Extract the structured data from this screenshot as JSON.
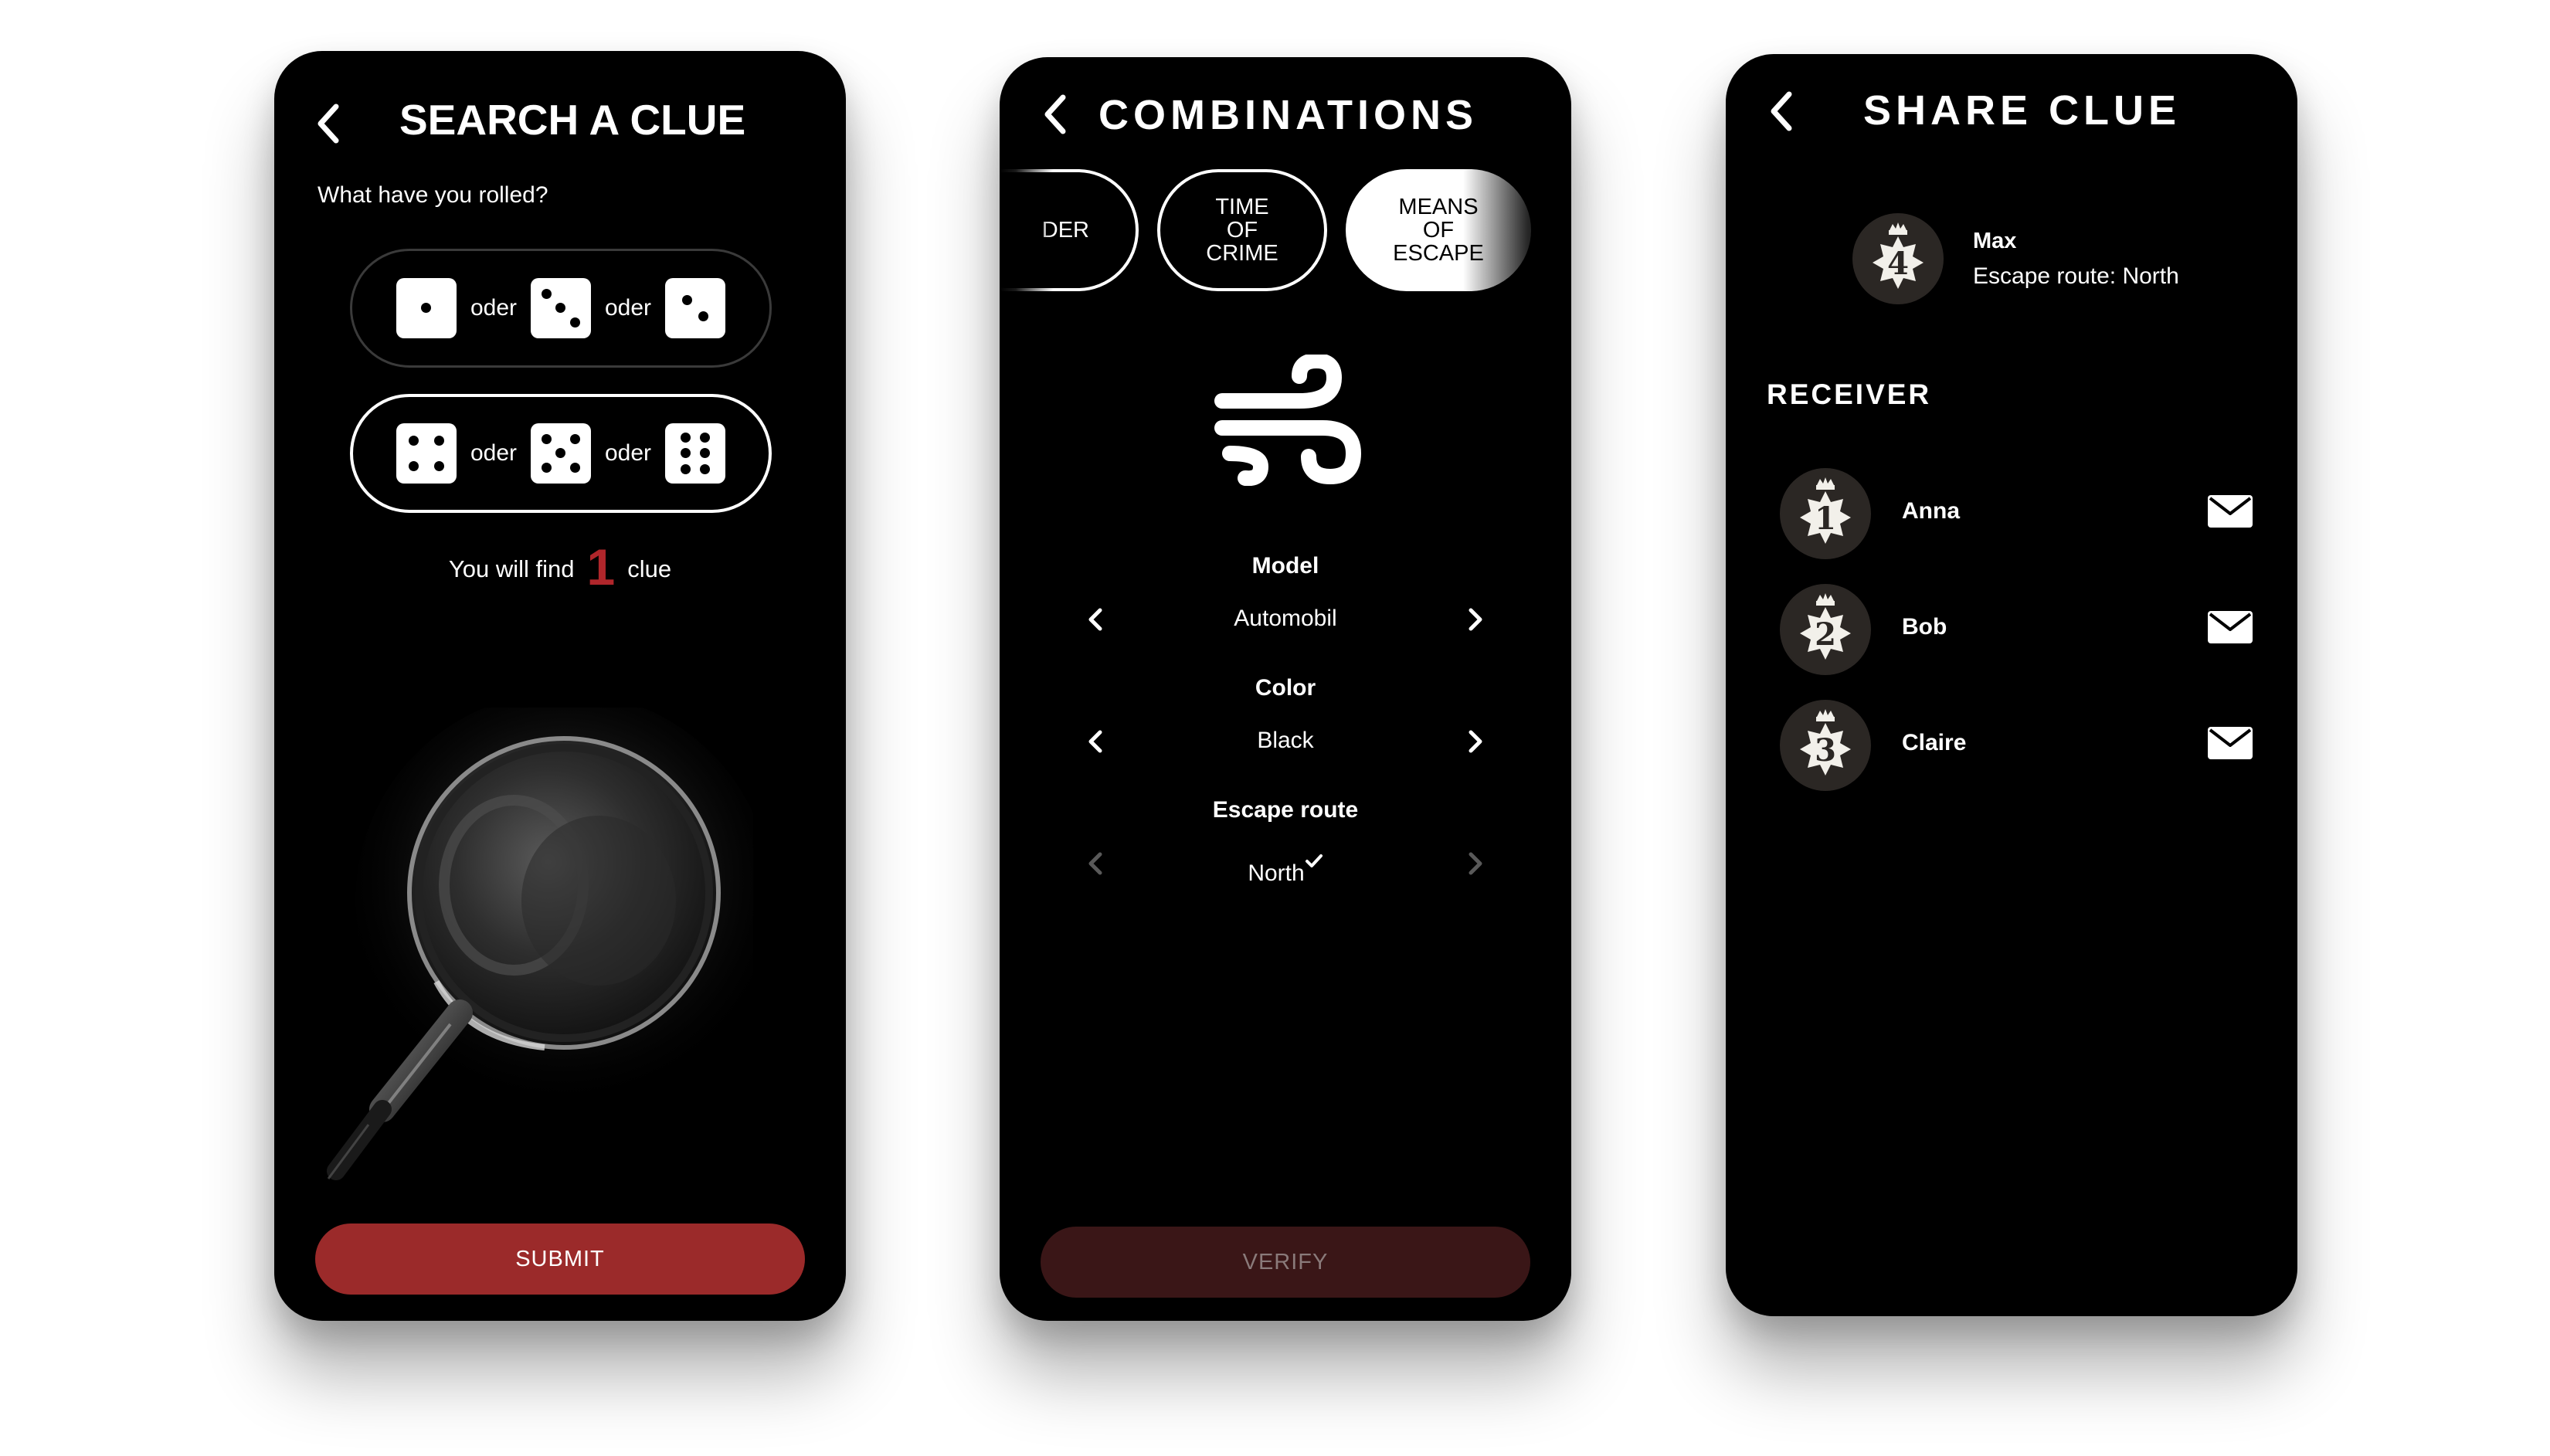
{
  "colors": {
    "background": "#ffffff",
    "screen": "#000000",
    "accent_red": "#9b2a2a",
    "number_red": "#b0262b",
    "disabled_button": "#3a1617"
  },
  "search_screen": {
    "back_icon": "chevron-left-icon",
    "title": "SEARCH A CLUE",
    "question": "What have you rolled?",
    "dice_groups": [
      {
        "faces": [
          1,
          3,
          2
        ],
        "separator_1": "oder",
        "separator_2": "oder",
        "selected": false
      },
      {
        "faces": [
          4,
          5,
          6
        ],
        "separator_1": "oder",
        "separator_2": "oder",
        "selected": true
      }
    ],
    "result_prefix": "You will find",
    "result_count": "1",
    "result_suffix": "clue",
    "illustration": "magnifying-glass",
    "submit_label": "SUBMIT"
  },
  "combinations_screen": {
    "back_icon": "chevron-left-icon",
    "title": "COMBINATIONS",
    "categories": [
      {
        "label": "DER",
        "state": "outline"
      },
      {
        "label": "TIME OF CRIME",
        "state": "outline"
      },
      {
        "label": "MEANS OF ESCAPE",
        "state": "filled"
      }
    ],
    "category_icon": "wind-icon",
    "selectors": [
      {
        "label": "Model",
        "value": "Automobil",
        "enabled": true
      },
      {
        "label": "Color",
        "value": "Black",
        "enabled": true
      },
      {
        "label": "Escape route",
        "value": "North",
        "confirmed": true,
        "enabled": false
      }
    ],
    "verify_label": "VERIFY"
  },
  "share_screen": {
    "back_icon": "chevron-left-icon",
    "title": "SHARE CLUE",
    "sender": {
      "badge_number": "4",
      "name": "Max",
      "clue": "Escape route: North"
    },
    "receiver_heading": "RECEIVER",
    "receivers": [
      {
        "badge_number": "1",
        "name": "Anna",
        "action_icon": "mail-icon"
      },
      {
        "badge_number": "2",
        "name": "Bob",
        "action_icon": "mail-icon"
      },
      {
        "badge_number": "3",
        "name": "Claire",
        "action_icon": "mail-icon"
      }
    ]
  }
}
